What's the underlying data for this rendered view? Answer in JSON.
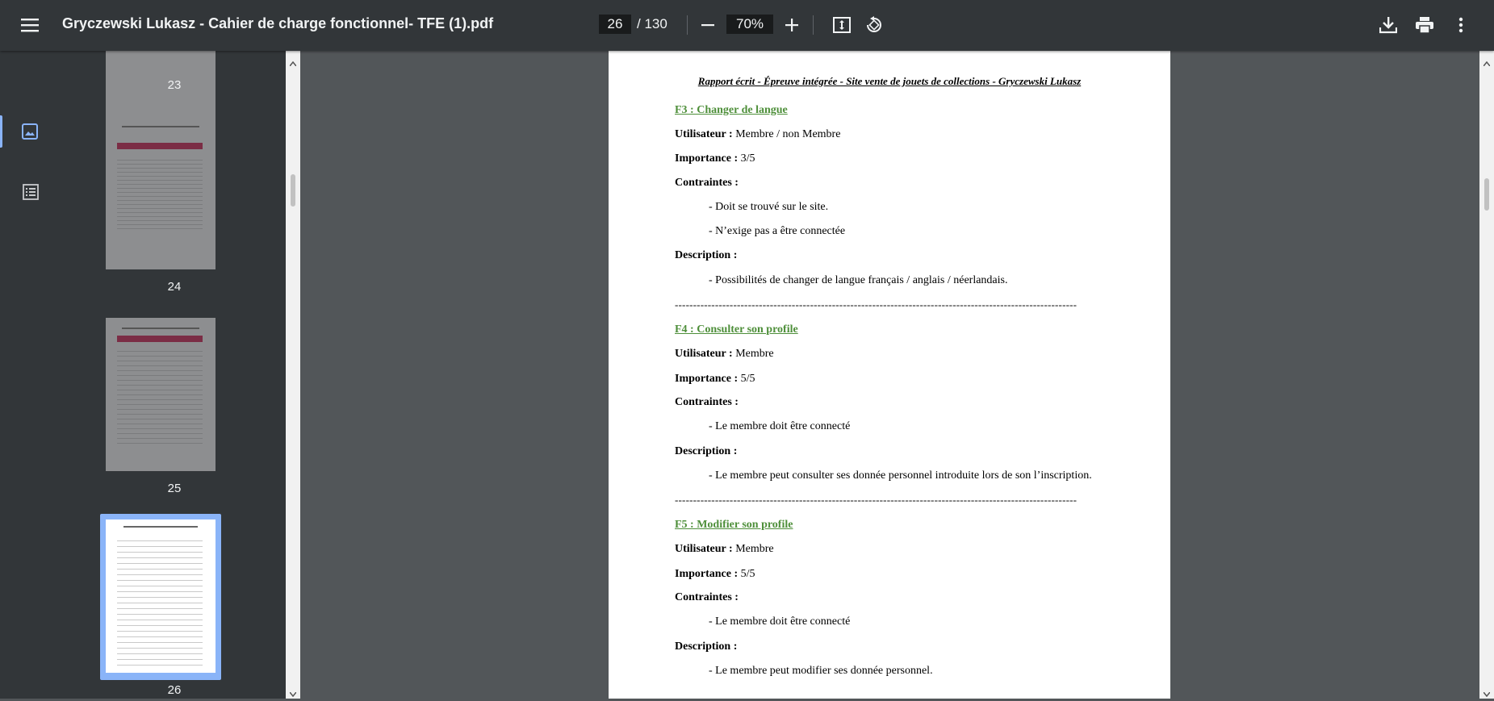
{
  "toolbar": {
    "title": "Gryczewski Lukasz - Cahier de charge fonctionnel- TFE (1).pdf",
    "page_current": "26",
    "page_total": "/ 130",
    "zoom": "70%"
  },
  "thumbnails": [
    {
      "label": "23"
    },
    {
      "label": "24"
    },
    {
      "label": "25"
    },
    {
      "label": "26"
    }
  ],
  "document": {
    "header": "Rapport écrit - Épreuve intégrée - Site vente de jouets de collections - Gryczewski Lukasz",
    "divider": "--------------------------------------------------------------------------------------------------------------",
    "sections": [
      {
        "title": "F3 : Changer de langue",
        "user_label": "Utilisateur :",
        "user_value": "Membre / non Membre",
        "importance_label": "Importance :",
        "importance_value": "3/5",
        "constraints_label": "Contraintes :",
        "constraints": [
          "- Doit se trouvé sur le site.",
          "- N’exige pas a être connectée"
        ],
        "description_label": "Description :",
        "description": [
          "- Possibilités de changer de langue français / anglais / néerlandais."
        ]
      },
      {
        "title": "F4 : Consulter son profile",
        "user_label": "Utilisateur :",
        "user_value": "Membre",
        "importance_label": "Importance :",
        "importance_value": "5/5",
        "constraints_label": "Contraintes :",
        "constraints": [
          "- Le membre doit être connecté"
        ],
        "description_label": "Description :",
        "description": [
          "- Le membre peut consulter ses donnée personnel introduite lors de son l’inscription."
        ]
      },
      {
        "title": "F5 : Modifier son profile",
        "user_label": "Utilisateur :",
        "user_value": "Membre",
        "importance_label": "Importance :",
        "importance_value": "5/5",
        "constraints_label": "Contraintes :",
        "constraints": [
          "- Le membre doit être connecté"
        ],
        "description_label": "Description :",
        "description": [
          "- Le membre peut modifier ses donnée personnel."
        ]
      }
    ]
  }
}
